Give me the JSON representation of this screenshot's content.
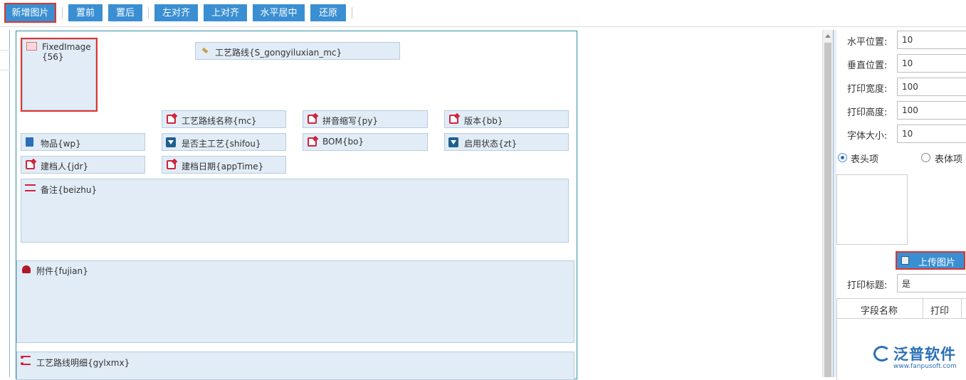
{
  "toolbar": {
    "add_image": "新增图片",
    "bring_front": "置前",
    "send_back": "置后",
    "align_left": "左对齐",
    "align_top": "上对齐",
    "center_horizontal": "水平居中",
    "restore": "还原"
  },
  "canvas": {
    "fixed_image": "FixedImage{56}",
    "route_field": "工艺路线{S_gongyiluxian_mc}",
    "fields": {
      "route_name": "工艺路线名称{mc}",
      "pinyin": "拼音缩写{py}",
      "version": "版本{bb}",
      "item": "物品{wp}",
      "is_main": "是否主工艺{shifou}",
      "bom": "BOM{bo}",
      "status": "启用状态{zt}",
      "creator": "建档人{jdr}",
      "create_date": "建档日期{appTime}",
      "remark": "备注{beizhu}",
      "attachment": "附件{fujian}",
      "detail": "工艺路线明细{gylxmx}"
    }
  },
  "props": {
    "h_pos_label": "水平位置:",
    "h_pos_value": "10",
    "v_pos_label": "垂直位置:",
    "v_pos_value": "10",
    "width_label": "打印宽度:",
    "width_value": "100",
    "height_label": "打印高度:",
    "height_value": "100",
    "font_label": "字体大小:",
    "font_value": "10",
    "radio_header": "表头项",
    "radio_body": "表体项",
    "upload_btn": "上传图片",
    "print_title_label": "打印标题:",
    "print_title_value": "是",
    "col_field_name": "字段名称",
    "col_print": "打印"
  },
  "watermark": {
    "brand": "泛普软件",
    "url": "www.fanpusoft.com"
  }
}
